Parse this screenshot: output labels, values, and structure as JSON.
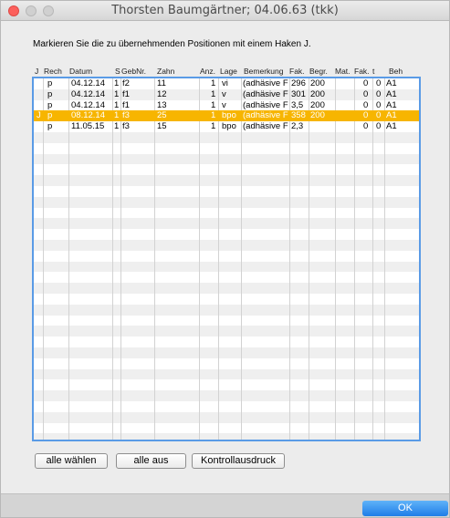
{
  "window": {
    "title": "Thorsten Baumgärtner; 04.06.63 (tkk)"
  },
  "instruction": "Markieren Sie die zu übernehmenden Positionen mit einem Haken J.",
  "table": {
    "columns": [
      "J",
      "Rech",
      "Datum",
      "S",
      "GebNr.",
      "Zahn",
      "Anz.",
      "Lage",
      "Bemerkung",
      "Fak.",
      "Begr.",
      "Mat.",
      "Fak.",
      "t",
      "Beh"
    ],
    "rows": [
      {
        "j": "",
        "rech": "p",
        "datum": "04.12.14",
        "s": "1",
        "gebnr": "f2",
        "zahn": "11",
        "anz": "1",
        "lage": "vi",
        "bemerkung": "(adhäsive F",
        "fak": "296",
        "begr": "200",
        "mat": "",
        "fak2": "0",
        "t": "0",
        "beh": "A1",
        "selected": false
      },
      {
        "j": "",
        "rech": "p",
        "datum": "04.12.14",
        "s": "1",
        "gebnr": "f1",
        "zahn": "12",
        "anz": "1",
        "lage": "v",
        "bemerkung": "(adhäsive F",
        "fak": "301",
        "begr": "200",
        "mat": "",
        "fak2": "0",
        "t": "0",
        "beh": "A1",
        "selected": false
      },
      {
        "j": "",
        "rech": "p",
        "datum": "04.12.14",
        "s": "1",
        "gebnr": "f1",
        "zahn": "13",
        "anz": "1",
        "lage": "v",
        "bemerkung": "(adhäsive F",
        "fak": "3,5",
        "begr": "200",
        "mat": "",
        "fak2": "0",
        "t": "0",
        "beh": "A1",
        "selected": false
      },
      {
        "j": "J",
        "rech": "p",
        "datum": "08.12.14",
        "s": "1",
        "gebnr": "f3",
        "zahn": "25",
        "anz": "1",
        "lage": "bpo",
        "bemerkung": "(adhäsive F",
        "fak": "358",
        "begr": "200",
        "mat": "",
        "fak2": "0",
        "t": "0",
        "beh": "A1",
        "selected": true
      },
      {
        "j": "",
        "rech": "p",
        "datum": "11.05.15",
        "s": "1",
        "gebnr": "f3",
        "zahn": "15",
        "anz": "1",
        "lage": "bpo",
        "bemerkung": "(adhäsive F",
        "fak": "2,3",
        "begr": "",
        "mat": "",
        "fak2": "0",
        "t": "0",
        "beh": "A1",
        "selected": false
      }
    ]
  },
  "buttons": {
    "alle_waehlen": "alle wählen",
    "alle_aus": "alle aus",
    "kontrollausdruck": "Kontrollausdruck",
    "ok": "OK"
  },
  "colors": {
    "selection": "#f7b500",
    "zebra": "#efefef",
    "table_border": "#5a9be6",
    "ok_button": "#1f7de8",
    "close_button": "#fc605c"
  }
}
